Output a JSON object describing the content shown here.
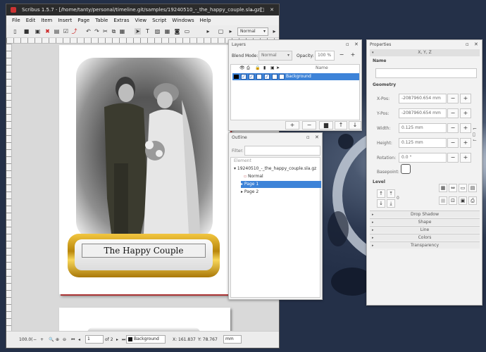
{
  "window": {
    "title": "Scribus 1.5.7 - [/home/tanty/personal/timeline.git/samples/19240510_-_the_happy_couple.sla.gz]"
  },
  "menu": [
    "File",
    "Edit",
    "Item",
    "Insert",
    "Page",
    "Table",
    "Extras",
    "View",
    "Script",
    "Windows",
    "Help"
  ],
  "toolbar": {
    "mode_select": "Normal"
  },
  "document": {
    "caption": "The Happy Couple"
  },
  "status": {
    "zoom": "100.0(",
    "page": "1",
    "of_pages": "of 2",
    "layer": "Background",
    "x_label": "X: 161.837",
    "y_label": "Y: 78.767",
    "unit": "mm"
  },
  "layers": {
    "title": "Layers",
    "blend_label": "Blend Mode:",
    "blend_value": "Normal",
    "opacity_label": "Opacity:",
    "opacity_value": "100 %",
    "name_header": "Name",
    "rows": [
      {
        "name": "Background"
      }
    ],
    "buttons": [
      "+",
      "−",
      "trash",
      "↑",
      "↓"
    ]
  },
  "outline": {
    "title": "Outline",
    "filter_label": "Filter:",
    "element_header": "Element",
    "root": "19240510_-_the_happy_couple.sla.gz",
    "items": [
      "Normal",
      "Page 1",
      "Page 2"
    ]
  },
  "properties": {
    "title": "Properties",
    "tab": "X, Y, Z",
    "name_label": "Name",
    "geometry_label": "Geometry",
    "xpos_label": "X-Pos:",
    "xpos_value": "-2087960.654 mm",
    "ypos_label": "Y-Pos:",
    "ypos_value": "-2087960.654 mm",
    "width_label": "Width:",
    "width_value": "0.125 mm",
    "height_label": "Height:",
    "height_value": "0.125 mm",
    "rotation_label": "Rotation:",
    "rotation_value": "0.0 °",
    "basepoint_label": "Basepoint:",
    "level_label": "Level",
    "level_value": "0",
    "sections": [
      "Drop Shadow",
      "Shape",
      "Line",
      "Colors",
      "Transparency"
    ]
  }
}
